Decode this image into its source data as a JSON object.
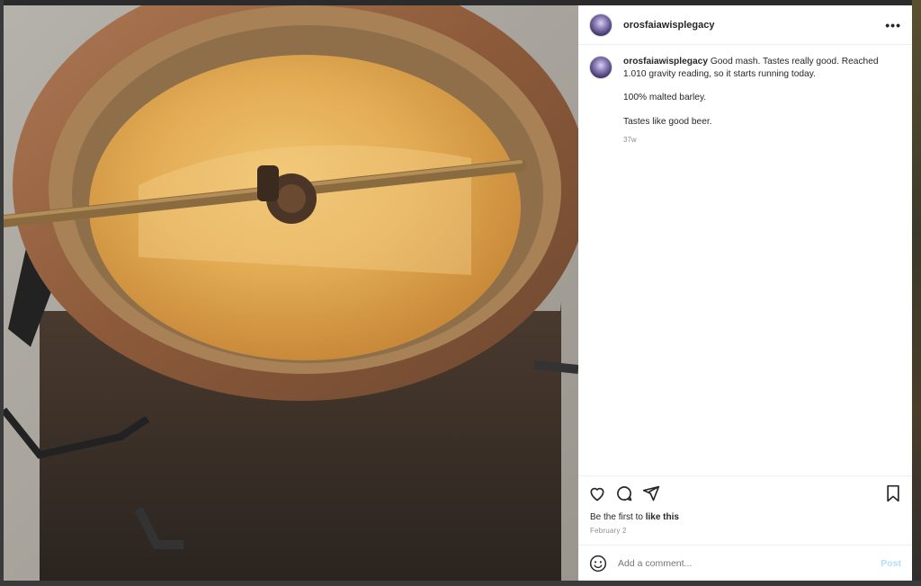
{
  "post": {
    "username": "orosfaiawisplegacy",
    "more_icon": "more-horizontal-icon",
    "photo_description_icon": "photo"
  },
  "caption": {
    "username": "orosfaiawisplegacy",
    "text_1": "Good mash. Tastes really good. Reached 1.010 gravity reading, so it starts running today.",
    "text_2": "100% malted barley.",
    "text_3": "Tastes like good beer.",
    "age": "37w"
  },
  "actions": {
    "like_icon": "heart-icon",
    "comment_icon": "comment-icon",
    "share_icon": "share-icon",
    "save_icon": "bookmark-icon"
  },
  "likes": {
    "prefix": "Be the first to ",
    "link": "like this"
  },
  "date": "February 2",
  "comment_box": {
    "placeholder": "Add a comment...",
    "post_label": "Post",
    "emoji_icon": "emoji-icon"
  },
  "colors": {
    "link_blue_disabled": "#b2dffc",
    "secondary_text": "#8e8e8e",
    "border": "#efefef"
  }
}
